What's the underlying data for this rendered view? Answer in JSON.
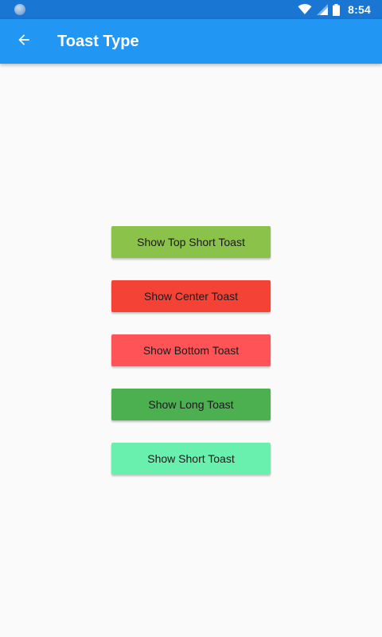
{
  "status_bar": {
    "time": "8:54",
    "color": "#1976d2"
  },
  "app_bar": {
    "title": "Toast Type",
    "back_icon": "arrow-back-icon",
    "color": "#2196f3"
  },
  "buttons": [
    {
      "label": "Show Top Short Toast",
      "color": "#8bc34a"
    },
    {
      "label": "Show Center Toast",
      "color": "#f44336"
    },
    {
      "label": "Show Bottom Toast",
      "color": "#ff5457"
    },
    {
      "label": "Show Long Toast",
      "color": "#4caf50"
    },
    {
      "label": "Show Short Toast",
      "color": "#69f0ae"
    }
  ]
}
